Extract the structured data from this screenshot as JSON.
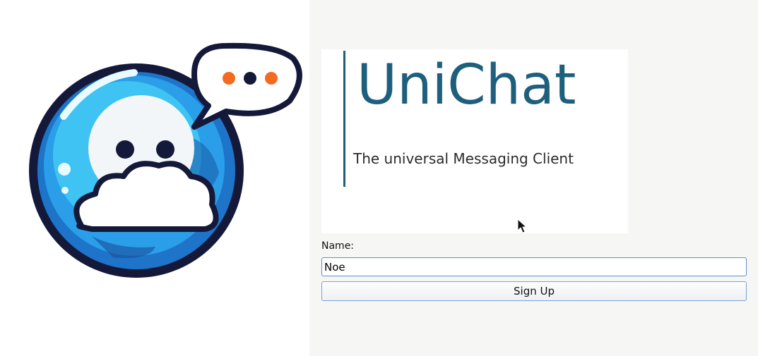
{
  "branding": {
    "title": "UniChat",
    "subtitle": "The universal Messaging Client"
  },
  "form": {
    "name_label": "Name:",
    "name_value": "Noe",
    "signup_label": "Sign Up"
  },
  "colors": {
    "brand": "#1e5f7d",
    "input_border": "#5b8ec9",
    "right_panel_bg": "#f6f6f5"
  },
  "icons": {
    "logo": "globe-chat-logo-icon",
    "cursor": "mouse-pointer-icon"
  }
}
